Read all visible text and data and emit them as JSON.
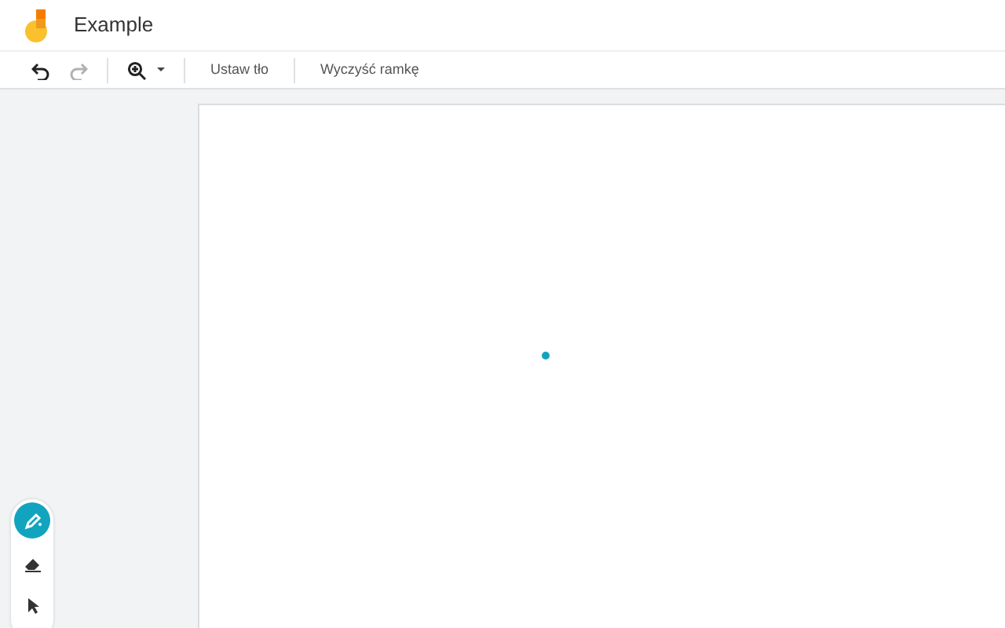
{
  "app": {
    "title": "Example"
  },
  "toolbar": {
    "undo": {
      "disabled": false
    },
    "redo": {
      "disabled": true
    },
    "zoom": {
      "disabled": false
    },
    "actions": [
      {
        "label": "Ustaw tło"
      },
      {
        "label": "Wyczyść ramkę"
      }
    ]
  },
  "tools": [
    {
      "kind": "pen",
      "selected": true
    },
    {
      "kind": "eraser",
      "selected": false
    },
    {
      "kind": "pointer",
      "selected": false
    }
  ]
}
